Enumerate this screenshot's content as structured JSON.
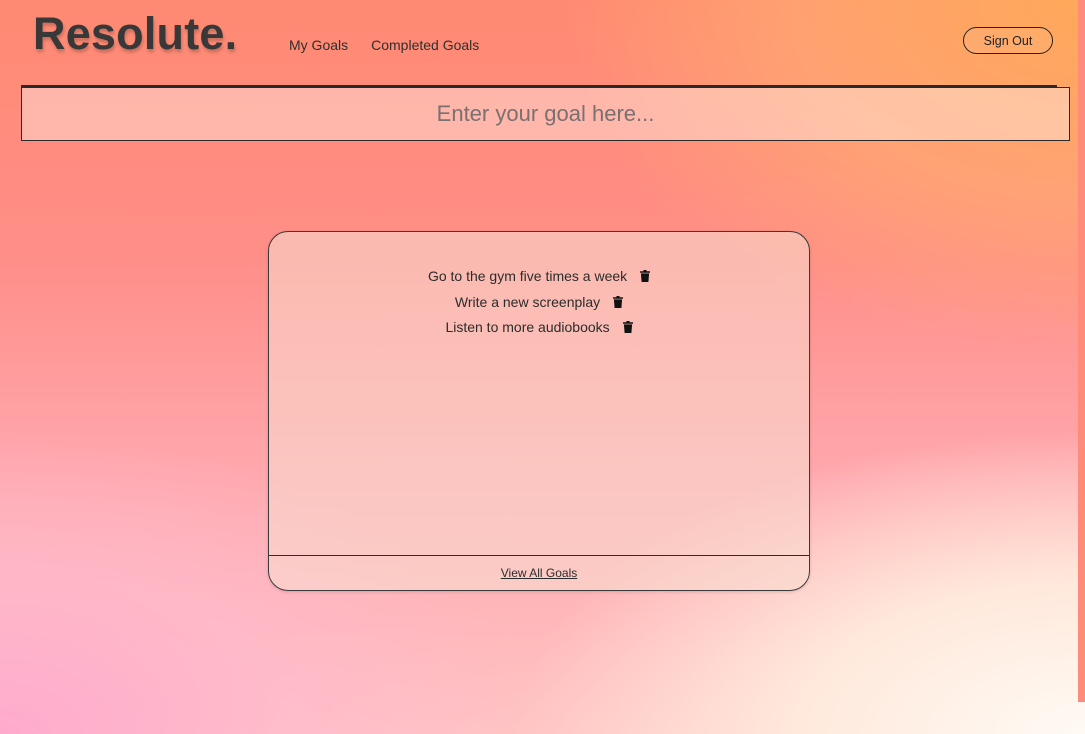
{
  "brand": {
    "logo": "Resolute."
  },
  "nav": {
    "items": [
      {
        "label": "My Goals"
      },
      {
        "label": "Completed Goals"
      }
    ]
  },
  "header": {
    "sign_out_label": "Sign Out"
  },
  "goal_input": {
    "placeholder": "Enter your goal here...",
    "value": ""
  },
  "goals_card": {
    "goals": [
      {
        "text": "Go to the gym five times a week",
        "icon": "trash-icon"
      },
      {
        "text": "Write a new screenplay",
        "icon": "trash-icon"
      },
      {
        "text": "Listen to more audiobooks",
        "icon": "trash-icon"
      }
    ],
    "view_all_label": "View All Goals"
  }
}
